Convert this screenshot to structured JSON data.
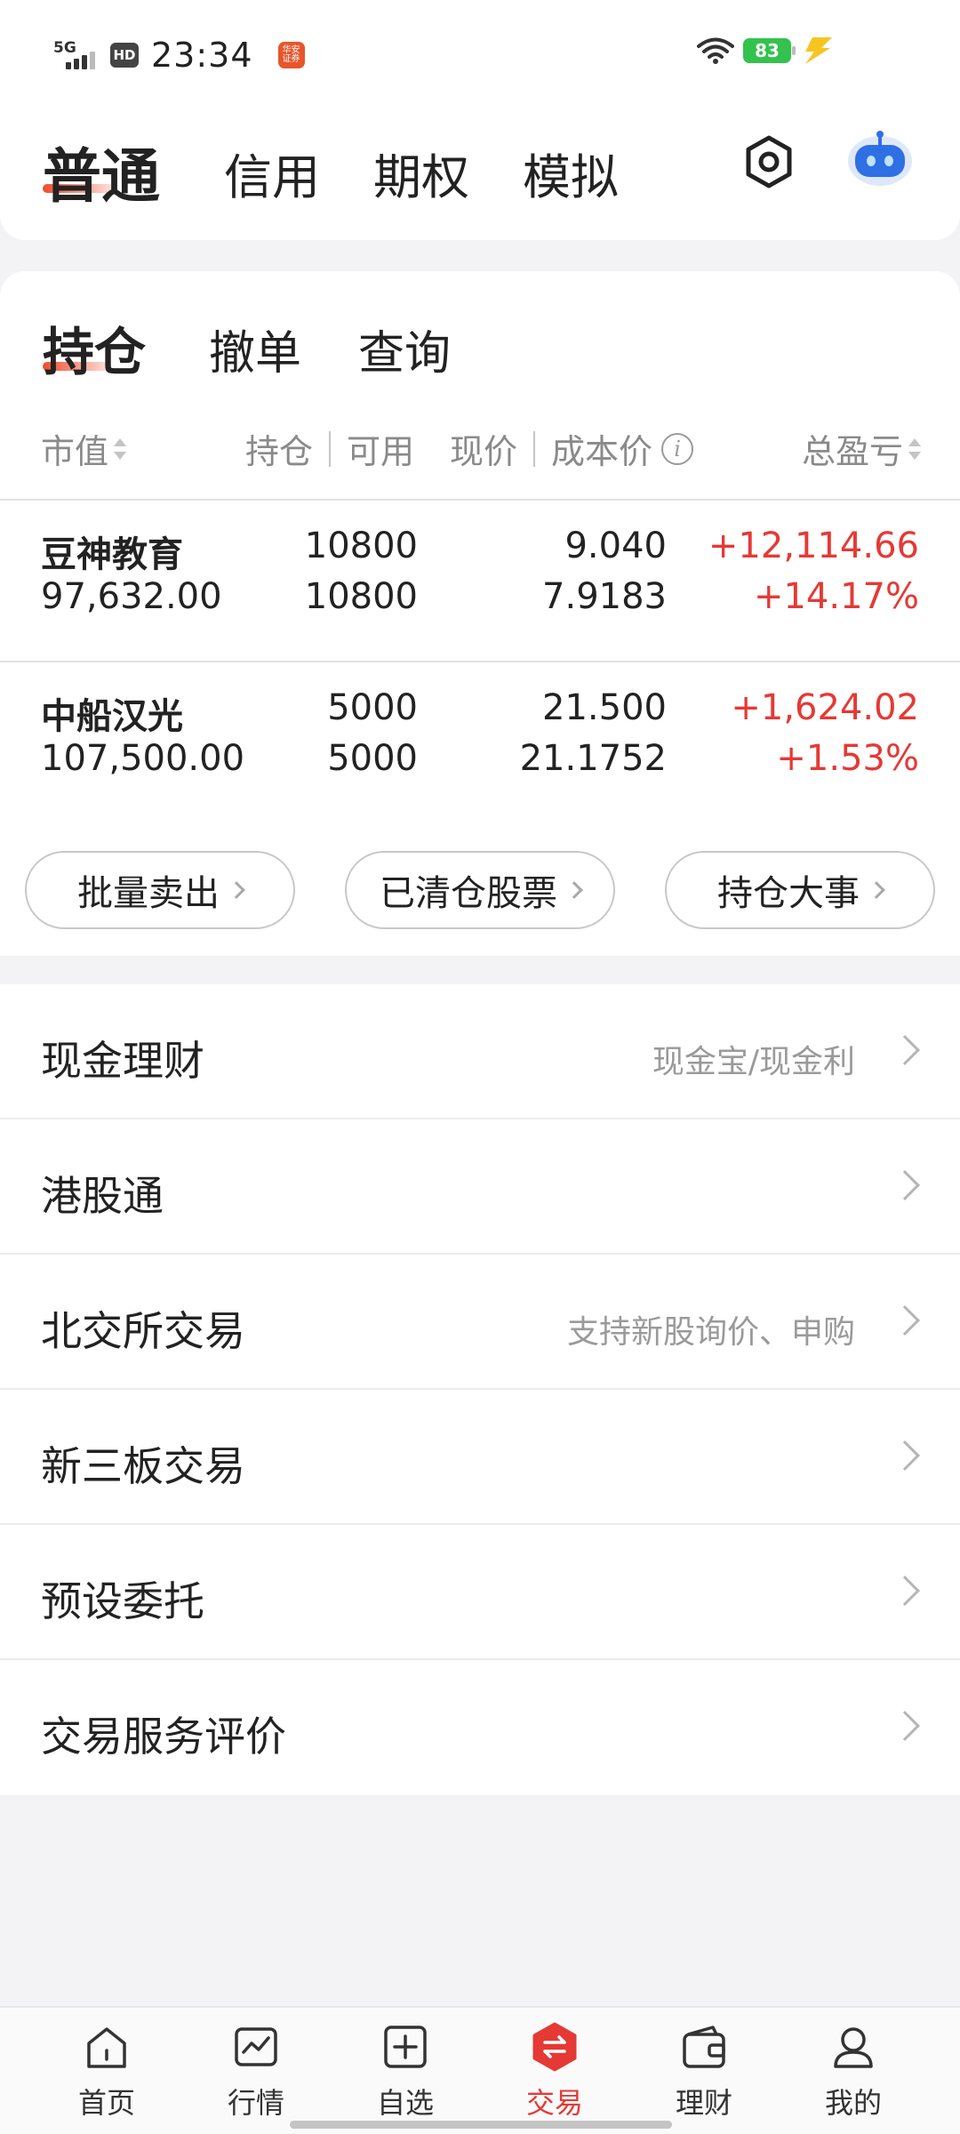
{
  "status_bar": {
    "network": "5G",
    "hd": "HD",
    "time": "23:34",
    "app_badge": "华安证券",
    "battery": "83"
  },
  "account_tabs": [
    {
      "label": "普通",
      "active": true
    },
    {
      "label": "信用",
      "active": false
    },
    {
      "label": "期权",
      "active": false
    },
    {
      "label": "模拟",
      "active": false
    }
  ],
  "sub_tabs": [
    {
      "label": "持仓",
      "active": true
    },
    {
      "label": "撤单",
      "active": false
    },
    {
      "label": "查询",
      "active": false
    }
  ],
  "columns": {
    "market_value": "市值",
    "holding": "持仓",
    "available": "可用",
    "price": "现价",
    "cost": "成本价",
    "info": "i",
    "pnl": "总盈亏"
  },
  "holdings": [
    {
      "name": "豆神教育",
      "market_value": "97,632.00",
      "holding": "10800",
      "available": "10800",
      "price": "9.040",
      "cost": "7.9183",
      "pnl": "+12,114.66",
      "pnl_pct": "+14.17%"
    },
    {
      "name": "中船汉光",
      "market_value": "107,500.00",
      "holding": "5000",
      "available": "5000",
      "price": "21.500",
      "cost": "21.1752",
      "pnl": "+1,624.02",
      "pnl_pct": "+1.53%"
    }
  ],
  "actions": [
    {
      "label": "批量卖出"
    },
    {
      "label": "已清仓股票"
    },
    {
      "label": "持仓大事"
    }
  ],
  "menu": [
    {
      "title": "现金理财",
      "sub": "现金宝/现金利"
    },
    {
      "title": "港股通",
      "sub": ""
    },
    {
      "title": "北交所交易",
      "sub": "支持新股询价、申购"
    },
    {
      "title": "新三板交易",
      "sub": ""
    },
    {
      "title": "预设委托",
      "sub": ""
    },
    {
      "title": "交易服务评价",
      "sub": ""
    }
  ],
  "bottom_nav": [
    {
      "label": "首页",
      "icon": "home-icon"
    },
    {
      "label": "行情",
      "icon": "chart-icon"
    },
    {
      "label": "自选",
      "icon": "add-watchlist-icon"
    },
    {
      "label": "交易",
      "icon": "trade-icon",
      "active": true
    },
    {
      "label": "理财",
      "icon": "wallet-icon"
    },
    {
      "label": "我的",
      "icon": "profile-icon"
    }
  ],
  "colors": {
    "accent": "#e53935",
    "profit": "#e53935",
    "background": "#f3f3f5"
  }
}
